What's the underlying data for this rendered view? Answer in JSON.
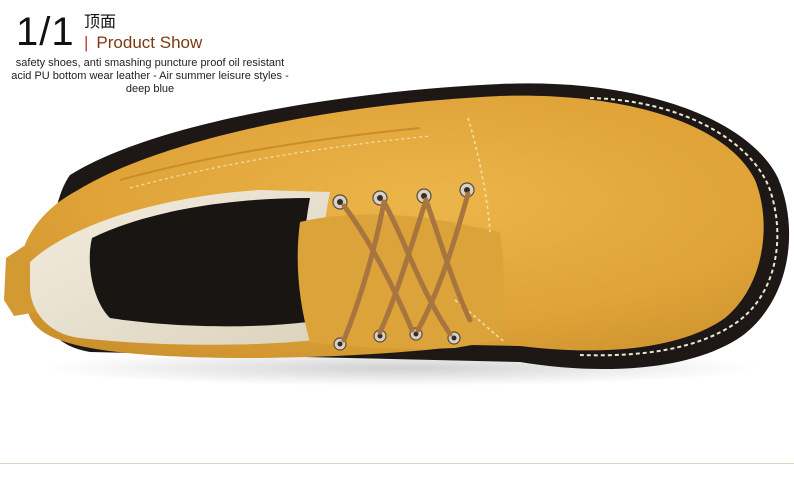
{
  "header": {
    "counter": "1/1",
    "view_title": "顶面",
    "separator": "|",
    "section_label": "Product Show",
    "description": "safety shoes, anti smashing puncture proof oil resistant acid PU bottom wear leather - Air summer leisure styles - deep blue"
  },
  "product": {
    "image_subject": "tan-suede-lace-up-shoe-top-view",
    "colors": {
      "suede": "#e0a63c",
      "sole": "#1d1815",
      "lining": "#ede6d3",
      "lace": "#a8753f",
      "accent_text": "#7a3a12"
    }
  }
}
